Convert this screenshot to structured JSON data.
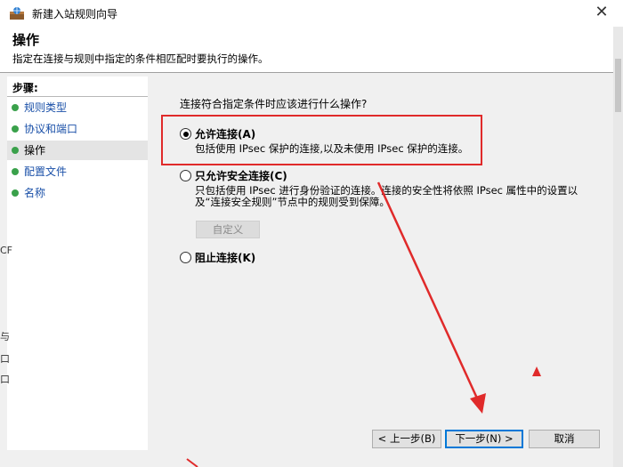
{
  "window": {
    "title": "新建入站规则向导"
  },
  "header": {
    "title": "操作",
    "description": "指定在连接与规则中指定的条件相匹配时要执行的操作。"
  },
  "steps": {
    "title": "步骤:",
    "items": [
      {
        "label": "规则类型"
      },
      {
        "label": "协议和端口"
      },
      {
        "label": "操作"
      },
      {
        "label": "配置文件"
      },
      {
        "label": "名称"
      }
    ],
    "active_index": 2
  },
  "main": {
    "question": "连接符合指定条件时应该进行什么操作?",
    "options": [
      {
        "label": "允许连接(A)",
        "description": "包括使用 IPsec 保护的连接,以及未使用 IPsec 保护的连接。",
        "selected": true
      },
      {
        "label": "只允许安全连接(C)",
        "description": "只包括使用 IPsec 进行身份验证的连接。连接的安全性将依照 IPsec 属性中的设置以及“连接安全规则”节点中的规则受到保障。",
        "selected": false
      },
      {
        "label": "阻止连接(K)",
        "description": "",
        "selected": false
      }
    ],
    "custom_button": "自定义"
  },
  "footer": {
    "back": "< 上一步(B)",
    "next": "下一步(N) >",
    "cancel": "取消"
  },
  "background_fragments": {
    "left_1": "CF",
    "left_2": "与",
    "left_3": "口",
    "left_4": "口"
  },
  "colors": {
    "annotation_red": "#e02a2a",
    "step_dot_green": "#3aa14b",
    "link_blue": "#1a50a8"
  }
}
